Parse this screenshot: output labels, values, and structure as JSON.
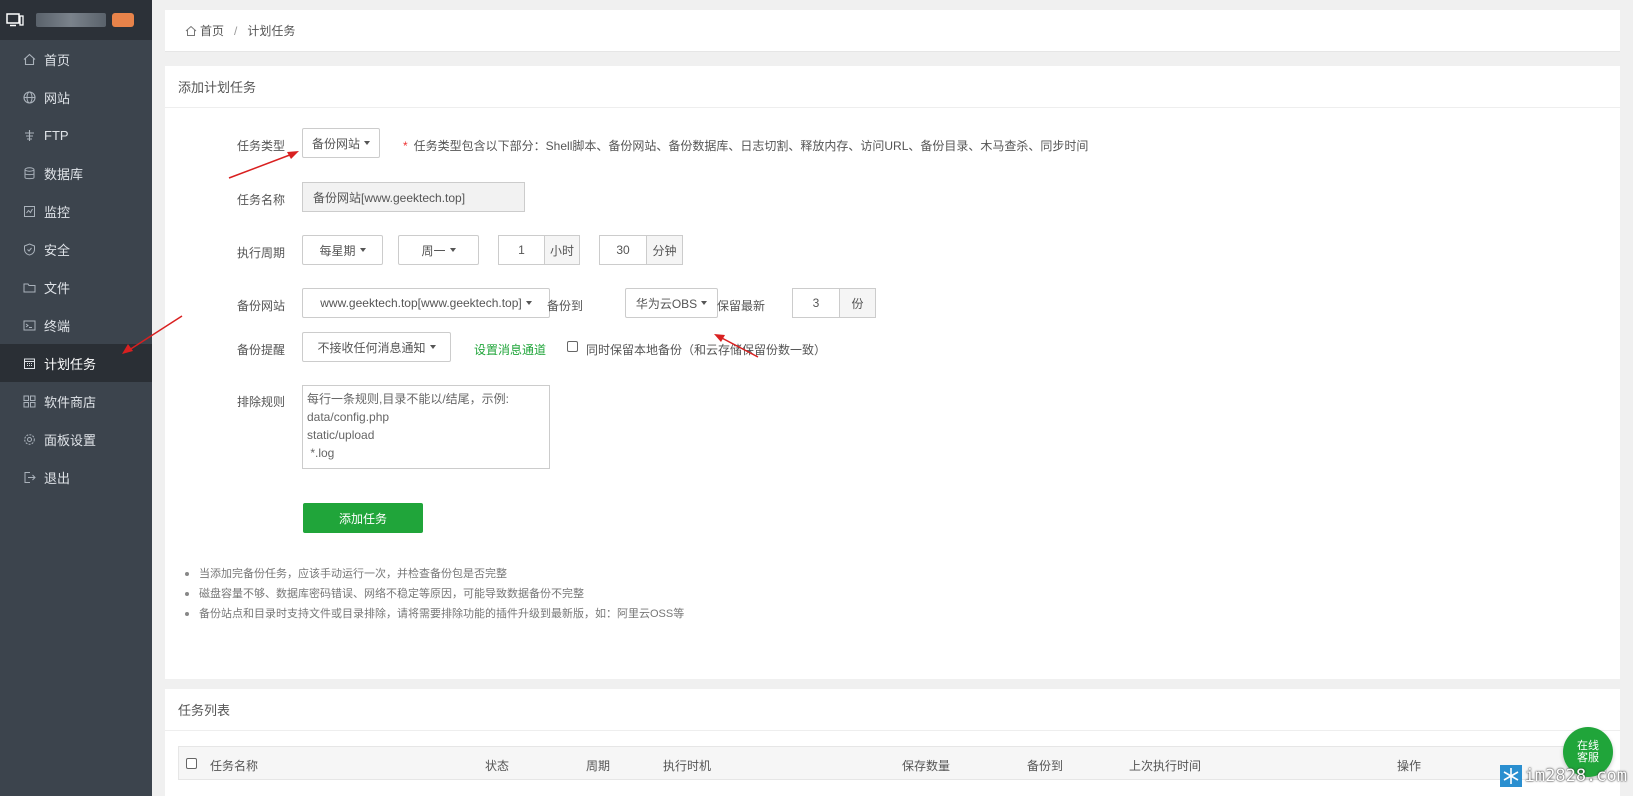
{
  "sidebar": {
    "items": [
      {
        "label": "首页",
        "icon": "home-icon"
      },
      {
        "label": "网站",
        "icon": "globe-icon"
      },
      {
        "label": "FTP",
        "icon": "ftp-icon"
      },
      {
        "label": "数据库",
        "icon": "database-icon"
      },
      {
        "label": "监控",
        "icon": "monitor-icon"
      },
      {
        "label": "安全",
        "icon": "shield-icon"
      },
      {
        "label": "文件",
        "icon": "folder-icon"
      },
      {
        "label": "终端",
        "icon": "terminal-icon"
      },
      {
        "label": "计划任务",
        "icon": "calendar-icon",
        "active": true
      },
      {
        "label": "软件商店",
        "icon": "apps-icon"
      },
      {
        "label": "面板设置",
        "icon": "gear-icon"
      },
      {
        "label": "退出",
        "icon": "logout-icon"
      }
    ]
  },
  "breadcrumb": {
    "home": "首页",
    "sep": "/",
    "current": "计划任务"
  },
  "form": {
    "title": "添加计划任务",
    "task_type_label": "任务类型",
    "task_type_value": "备份网站",
    "task_type_hint_star": "*",
    "task_type_hint": "任务类型包含以下部分：Shell脚本、备份网站、备份数据库、日志切割、释放内存、访问URL、备份目录、木马查杀、同步时间",
    "task_name_label": "任务名称",
    "task_name_value": "备份网站[www.geektech.top]",
    "period_label": "执行周期",
    "period_type": "每星期",
    "period_day": "周一",
    "hour_value": "1",
    "hour_unit": "小时",
    "minute_value": "30",
    "minute_unit": "分钟",
    "backup_site_label": "备份网站",
    "backup_site_value": "www.geektech.top[www.geektech.top]",
    "backup_to_label": "备份到",
    "backup_to_value": "华为云OBS",
    "keep_label": "保留最新",
    "keep_value": "3",
    "keep_unit": "份",
    "notify_label": "备份提醒",
    "notify_value": "不接收任何消息通知",
    "notify_link": "设置消息通道",
    "local_backup_label": "同时保留本地备份（和云存储保留份数一致）",
    "local_backup_checked": false,
    "exclude_label": "排除规则",
    "exclude_placeholder_lines": [
      "每行一条规则,目录不能以/结尾，示例:",
      "data/config.php",
      "static/upload",
      " *.log"
    ],
    "submit_label": "添加任务"
  },
  "notes": [
    "当添加完备份任务，应该手动运行一次，并检查备份包是否完整",
    "磁盘容量不够、数据库密码错误、网络不稳定等原因，可能导致数据备份不完整",
    "备份站点和目录时支持文件或目录排除，请将需要排除功能的插件升级到最新版，如：阿里云OSS等"
  ],
  "task_list": {
    "title": "任务列表",
    "columns": [
      "任务名称",
      "状态",
      "周期",
      "执行时机",
      "保存数量",
      "备份到",
      "上次执行时间",
      "操作"
    ]
  },
  "float_button": {
    "line1": "在线",
    "line2": "客服"
  },
  "watermark": "im2828.com",
  "colors": {
    "sidebar_bg": "#3c444d",
    "accent_green": "#20a53a",
    "warning_red": "#e33"
  }
}
